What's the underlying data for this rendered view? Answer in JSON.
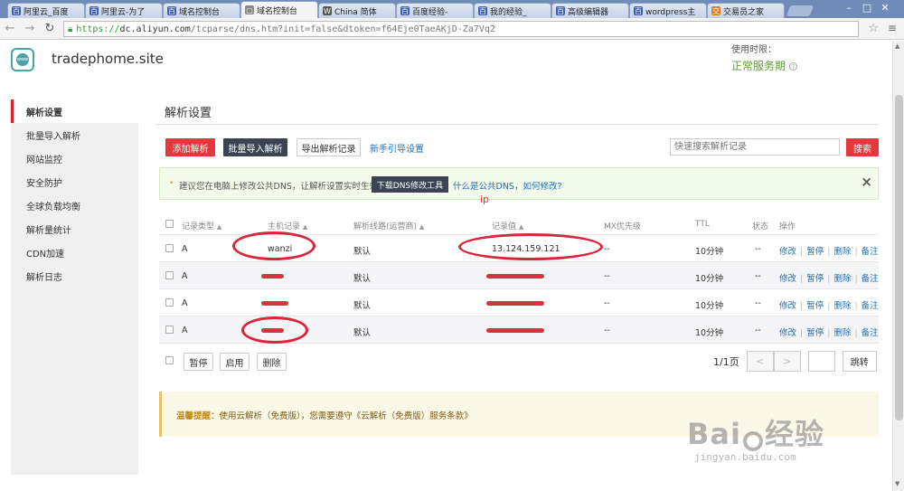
{
  "browser": {
    "tabs": [
      {
        "label": "阿里云_百度",
        "color": "#3c5fb0",
        "glyph": "百"
      },
      {
        "label": "阿里云-为了",
        "color": "#3c5fb0",
        "glyph": "百"
      },
      {
        "label": "域名控制台",
        "color": "#3c5fb0",
        "glyph": "百"
      },
      {
        "label": "域名控制台",
        "color": "#888888",
        "glyph": "▢",
        "active": true
      },
      {
        "label": "China 简体",
        "color": "#555555",
        "glyph": "W"
      },
      {
        "label": "百度经验-",
        "color": "#3c5fb0",
        "glyph": "百"
      },
      {
        "label": "我的经验_",
        "color": "#3c5fb0",
        "glyph": "百"
      },
      {
        "label": "高级编辑器",
        "color": "#3c5fb0",
        "glyph": "百"
      },
      {
        "label": "wordpress主",
        "color": "#3c5fb0",
        "glyph": "百"
      },
      {
        "label": "交易员之家",
        "color": "#e07a1f",
        "glyph": "交"
      }
    ],
    "url_scheme": "https://",
    "url_host": "dc.aliyun.com",
    "url_path": "/tcparse/dns.htm?init=false&dtoken=f64Eje0TaeAKjD-Za7Vq2"
  },
  "header": {
    "domain": "tradерhome.site",
    "service_time_label": "使用时限：",
    "service_status": "正常服务期"
  },
  "sidebar": {
    "items": [
      {
        "label": "解析设置",
        "active": true
      },
      {
        "label": "批量导入解析"
      },
      {
        "label": "网站监控"
      },
      {
        "label": "安全防护"
      },
      {
        "label": "全球负载均衡"
      },
      {
        "label": "解析量统计"
      },
      {
        "label": "CDN加速"
      },
      {
        "label": "解析日志"
      }
    ]
  },
  "main": {
    "title": "解析设置",
    "toolbar": {
      "add": "添加解析",
      "bulk_import": "批量导入解析",
      "export": "导出解析记录",
      "guide": "新手引导设置",
      "search_placeholder": "快速搜索解析记录",
      "search": "搜索"
    },
    "tip": {
      "text": "建议您在电脑上修改公共DNS，让解析设置实时生效。",
      "tool_button": "下载DNS修改工具",
      "link1": "什么是公共DNS",
      "link_sep": "，",
      "link2": "如何修改?",
      "close": "×"
    },
    "annotation": "ip",
    "table": {
      "columns": [
        "记录类型",
        "主机记录",
        "解析线路(运营商)",
        "记录值",
        "MX优先级",
        "TTL",
        "状态",
        "操作"
      ],
      "rows": [
        {
          "type": "A",
          "host": "wanzi",
          "line": "默认",
          "value": "13.124.159.121",
          "mx": "--",
          "ttl": "10分钟",
          "status": "--"
        },
        {
          "type": "A",
          "host": "",
          "line": "默认",
          "value": "",
          "mx": "--",
          "ttl": "10分钟",
          "status": "--"
        },
        {
          "type": "A",
          "host": "",
          "line": "默认",
          "value": "",
          "mx": "--",
          "ttl": "10分钟",
          "status": "--"
        },
        {
          "type": "A",
          "host": "",
          "line": "默认",
          "value": "",
          "mx": "--",
          "ttl": "10分钟",
          "status": "--"
        }
      ],
      "ops": [
        "修改",
        "暂停",
        "删除",
        "备注"
      ],
      "bulk": {
        "pause": "暂停",
        "enable": "启用",
        "delete": "删除"
      },
      "pager": {
        "text": "1/1页",
        "prev": "<",
        "next": ">",
        "jump": "跳转"
      }
    },
    "notice": {
      "label": "温馨提醒：",
      "text": "使用云解析（免费版），您需要遵守《云解析（免费版）服务条款》"
    }
  },
  "watermark": {
    "main": "Bai",
    "main2": "经验",
    "sub": "jingyan.baidu.com"
  }
}
